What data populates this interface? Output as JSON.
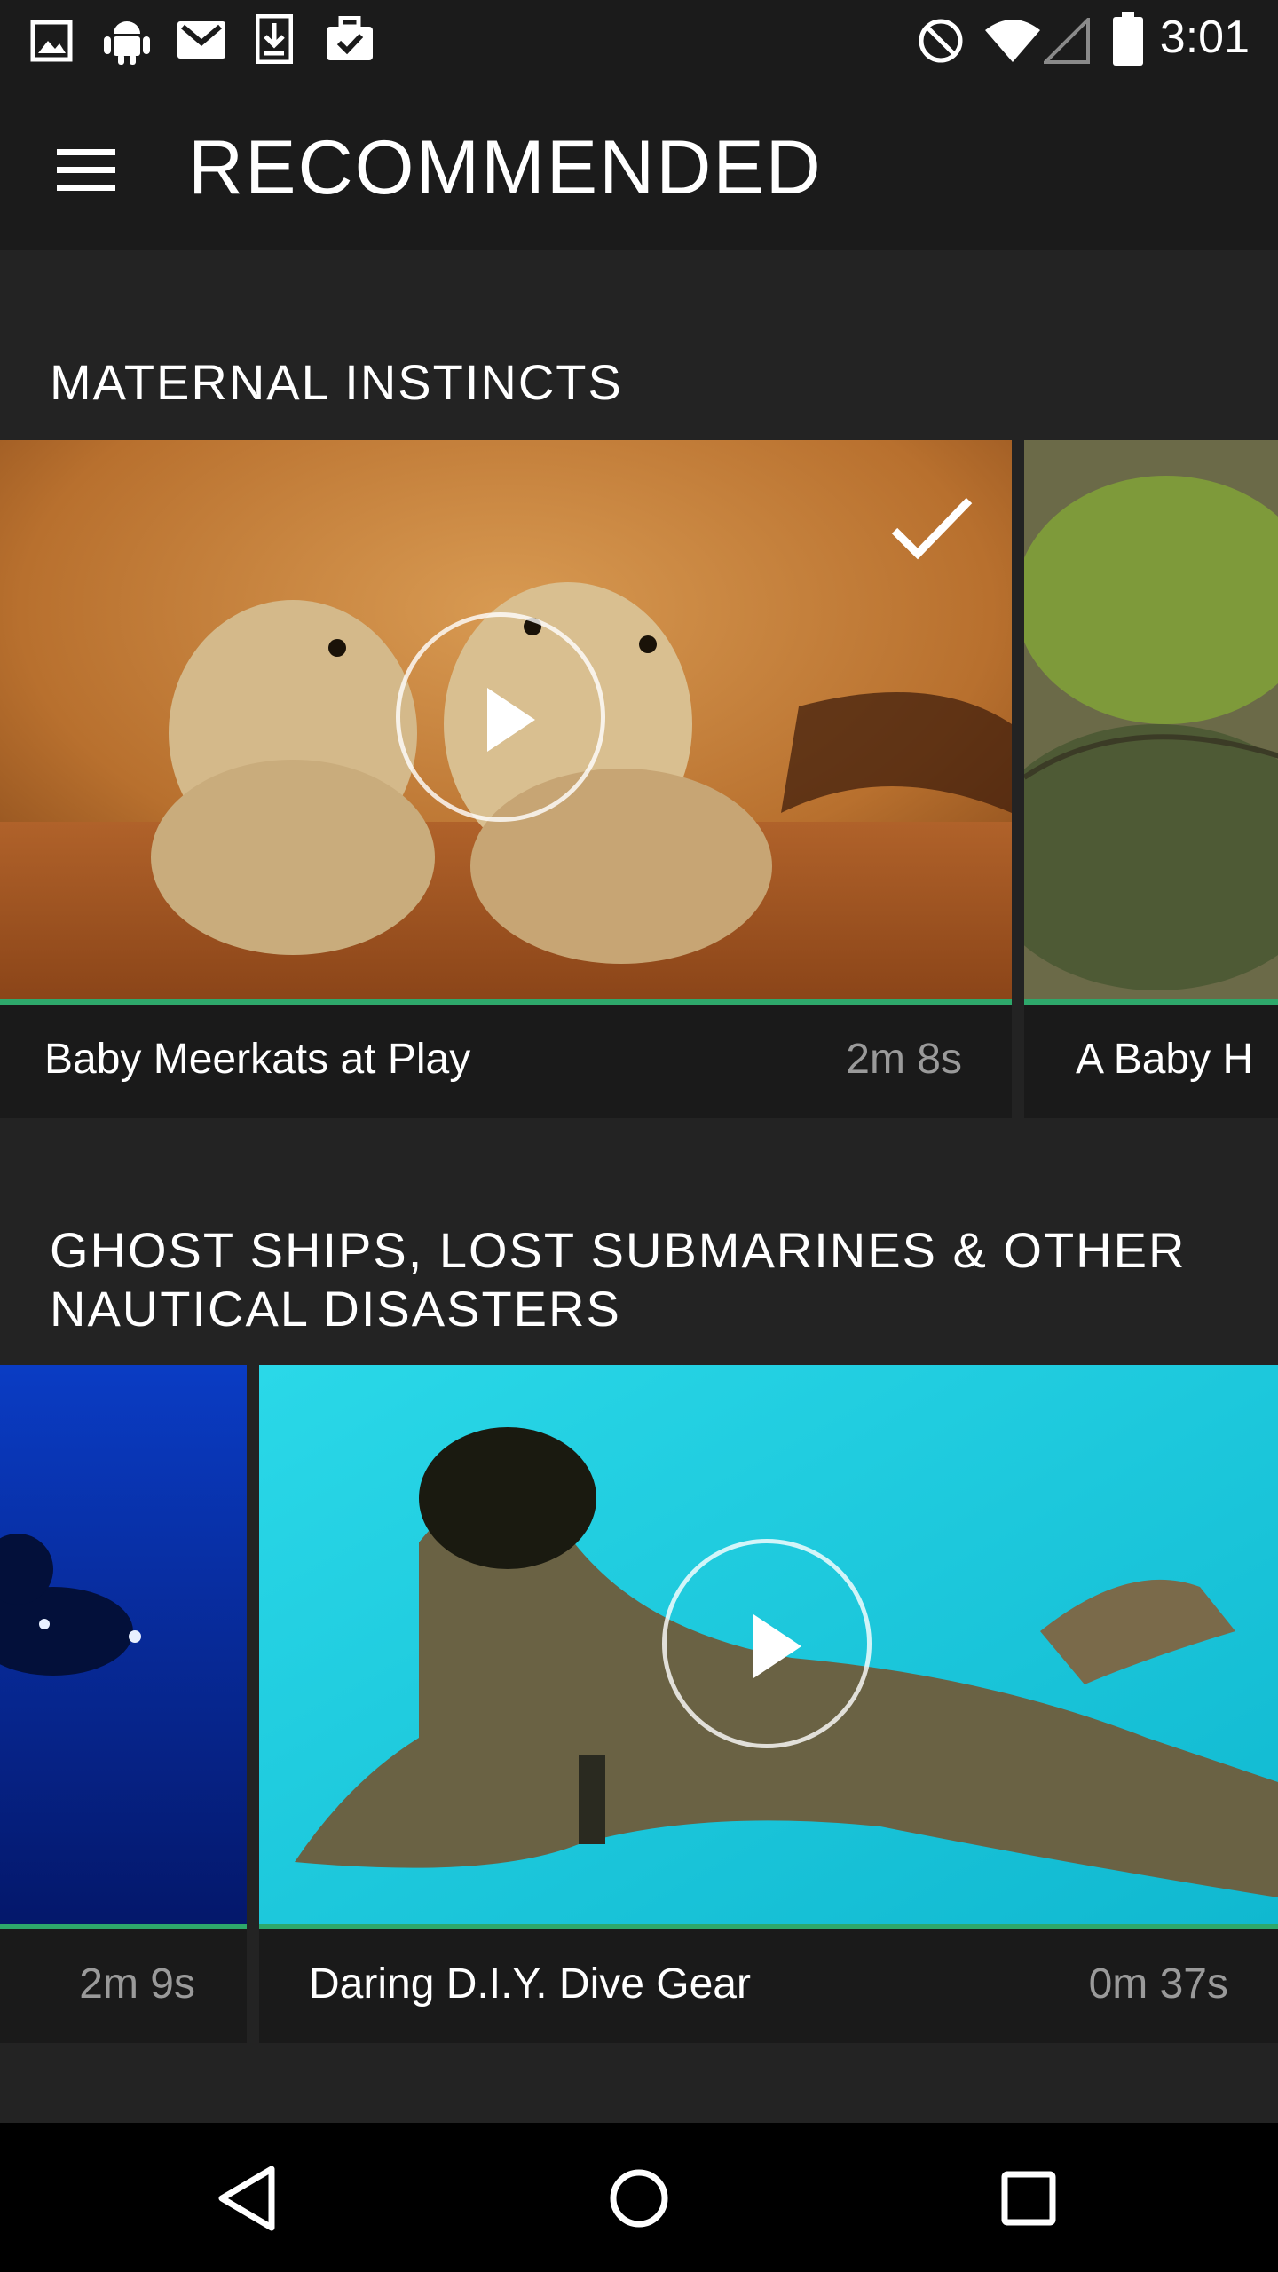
{
  "status_bar": {
    "time": "3:01",
    "icons": [
      "image-icon",
      "android-icon",
      "gmail-icon",
      "download-icon",
      "briefcase-check-icon",
      "do-not-disturb-icon",
      "wifi-icon",
      "cell-signal-icon",
      "battery-icon"
    ]
  },
  "app_bar": {
    "menu_icon": "hamburger-menu-icon",
    "title": "RECOMMENDED"
  },
  "sections": [
    {
      "title": "MATERNAL INSTINCTS",
      "cards": [
        {
          "title": "Baby Meerkats at Play",
          "duration": "2m 8s",
          "watched": true,
          "progress": 1.0
        },
        {
          "title": "A Baby H",
          "duration": "",
          "progress": 1.0
        }
      ]
    },
    {
      "title_line1": "GHOST SHIPS, LOST SUBMARINES & OTHER",
      "title_line2": "NAUTICAL DISASTERS",
      "cards": [
        {
          "title": "",
          "duration": "2m 9s",
          "progress": 1.0
        },
        {
          "title": "Daring D.I.Y. Dive Gear",
          "duration": "0m 37s",
          "progress": 1.0
        }
      ]
    }
  ],
  "nav_bar": {
    "back": "back-icon",
    "home": "home-icon",
    "recents": "recents-icon"
  },
  "colors": {
    "background": "#232323",
    "bars": "#1b1b1b",
    "card": "#1a1a1a",
    "progress_accent": "#2ea86b",
    "duration_text": "#9a9a9a"
  }
}
